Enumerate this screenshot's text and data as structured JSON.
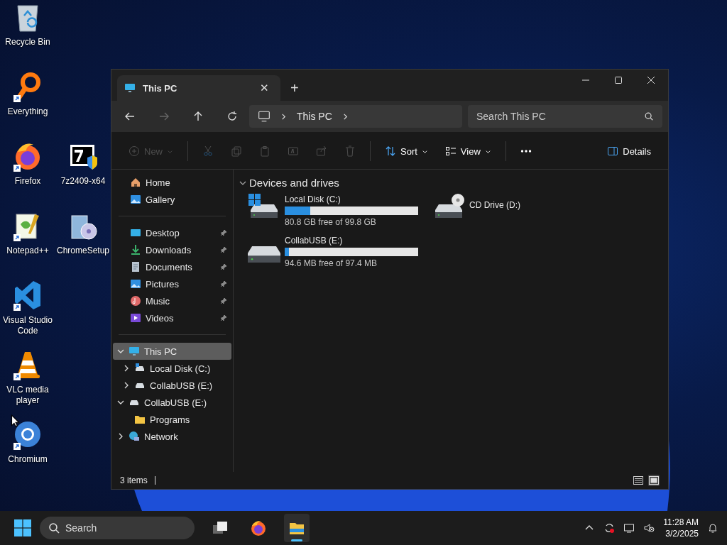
{
  "desktop_icons": [
    [
      {
        "label": "Recycle Bin",
        "kind": "recycle",
        "shortcut": false
      }
    ],
    [
      {
        "label": "Everything",
        "kind": "everything",
        "shortcut": true
      }
    ],
    [
      {
        "label": "Firefox",
        "kind": "firefox",
        "shortcut": true
      },
      {
        "label": "7z2409-x64",
        "kind": "sevenzip",
        "shortcut": false
      }
    ],
    [
      {
        "label": "Notepad++",
        "kind": "notepad",
        "shortcut": true
      },
      {
        "label": "ChromeSetup",
        "kind": "installer",
        "shortcut": false
      }
    ],
    [
      {
        "label": "Visual Studio Code",
        "kind": "vscode",
        "shortcut": true
      }
    ],
    [
      {
        "label": "VLC media player",
        "kind": "vlc",
        "shortcut": true
      }
    ],
    [
      {
        "label": "Chromium",
        "kind": "chromium",
        "shortcut": true
      }
    ]
  ],
  "window": {
    "tab": {
      "title": "This PC",
      "close": "✕",
      "new_tab": "+"
    },
    "address": {
      "crumbs": [
        "This PC"
      ],
      "search_placeholder": "Search This PC"
    },
    "commands": [
      {
        "kind": "new",
        "label": "New",
        "disabled": true
      },
      {
        "kind": "cut",
        "disabled": true
      },
      {
        "kind": "copy",
        "disabled": true
      },
      {
        "kind": "paste",
        "disabled": true
      },
      {
        "kind": "rename",
        "disabled": true
      },
      {
        "kind": "share",
        "disabled": true
      },
      {
        "kind": "delete",
        "disabled": true
      },
      {
        "kind": "sort",
        "label": "Sort",
        "disabled": false
      },
      {
        "kind": "view",
        "label": "View",
        "disabled": false
      },
      {
        "kind": "more",
        "disabled": false
      }
    ],
    "details_button": "Details",
    "sidebar": {
      "top": [
        {
          "label": "Home",
          "kind": "home"
        },
        {
          "label": "Gallery",
          "kind": "gallery"
        }
      ],
      "pinned": [
        {
          "label": "Desktop",
          "kind": "desktop",
          "pinned": true
        },
        {
          "label": "Downloads",
          "kind": "downloads",
          "pinned": true
        },
        {
          "label": "Documents",
          "kind": "documents",
          "pinned": true
        },
        {
          "label": "Pictures",
          "kind": "pictures",
          "pinned": true
        },
        {
          "label": "Music",
          "kind": "music",
          "pinned": true
        },
        {
          "label": "Videos",
          "kind": "videos",
          "pinned": true
        }
      ],
      "tree": [
        {
          "label": "This PC",
          "kind": "pc",
          "expanded": true,
          "selected": true,
          "children": [
            {
              "label": "Local Disk (C:)",
              "kind": "disk",
              "expanded": false,
              "selected": false
            },
            {
              "label": "CollabUSB (E:)",
              "kind": "usb",
              "expanded": false,
              "selected": false
            }
          ]
        },
        {
          "label": "CollabUSB (E:)",
          "kind": "usb",
          "expanded": true,
          "selected": false,
          "children": [
            {
              "label": "Programs",
              "kind": "folder",
              "selected": false
            }
          ]
        },
        {
          "label": "Network",
          "kind": "network",
          "expanded": false,
          "selected": false
        }
      ]
    },
    "group": {
      "title": "Devices and drives",
      "expanded": true
    },
    "drives": [
      {
        "name": "Local Disk (C:)",
        "kind": "system",
        "level": 0.19,
        "free": "80.8 GB free of 99.8 GB"
      },
      {
        "name": "CD Drive (D:)",
        "kind": "cd"
      },
      {
        "name": "CollabUSB (E:)",
        "kind": "usb",
        "level": 0.03,
        "free": "94.6 MB free of 97.4 MB"
      }
    ],
    "status": "3 items",
    "view_modes": [
      {
        "kind": "details",
        "selected": false
      },
      {
        "kind": "tiles",
        "selected": true
      }
    ]
  },
  "taskbar": {
    "search_placeholder": "Search",
    "apps": [
      {
        "kind": "taskview",
        "active": false
      },
      {
        "kind": "firefox",
        "active": false
      },
      {
        "kind": "explorer",
        "active": true
      }
    ],
    "time": "11:28 AM",
    "date": "3/2/2025"
  }
}
